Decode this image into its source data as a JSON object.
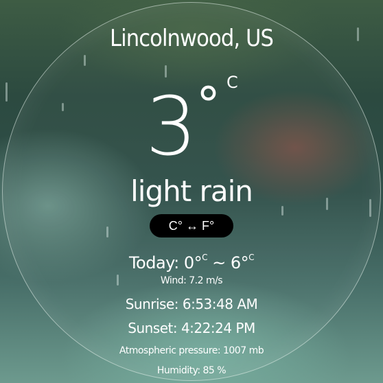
{
  "location": {
    "city": "Lincolnwood, US"
  },
  "current": {
    "temperature": "3",
    "degree_symbol": "°",
    "unit": "C",
    "description": "light rain"
  },
  "toggle": {
    "label": "C° ↔ F°"
  },
  "today": {
    "prefix": "Today: ",
    "min": "0°",
    "min_unit": "C",
    "separator": " ~ ",
    "max": "6°",
    "max_unit": "C"
  },
  "details": {
    "wind": "Wind: 7.2 m/s",
    "sunrise": "Sunrise: 6:53:48 AM",
    "sunset": "Sunset: 4:22:24 PM",
    "pressure": "Atmospheric pressure: 1007 mb",
    "humidity": "Humidity: 85 %"
  },
  "colors": {
    "text": "#ffffff",
    "toggle_bg": "#000000"
  },
  "icons": {
    "toggle": "swap-arrows"
  }
}
